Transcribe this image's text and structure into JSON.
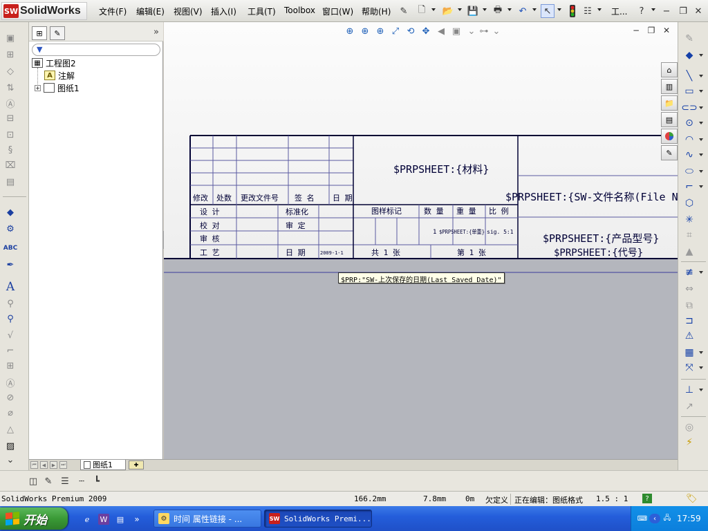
{
  "app": {
    "logo_text": "SolidWorks"
  },
  "menubar": {
    "items": [
      {
        "label": "文件(F)"
      },
      {
        "label": "编辑(E)"
      },
      {
        "label": "视图(V)"
      },
      {
        "label": "插入(I)"
      },
      {
        "label": "工具(T)"
      },
      {
        "label": "Toolbox"
      },
      {
        "label": "窗口(W)"
      },
      {
        "label": "帮助(H)"
      }
    ],
    "overflow_label": "工..."
  },
  "feature_tree": {
    "root": "工程图2",
    "children": [
      {
        "label": "注解",
        "icon": "annotation-icon",
        "icon_glyph": "A"
      },
      {
        "label": "图纸1",
        "icon": "sheet-icon",
        "expandable": true,
        "expander": "+"
      }
    ],
    "expand_glyph": "»"
  },
  "title_block": {
    "material": "$PRPSHEET:{材料}",
    "file_name": "$PRPSHEET:{SW-文件名称(File Name)}",
    "product_model": "$PRPSHEET:{产品型号}",
    "code": "$PRPSHEET:{代号}",
    "rev_headers": [
      "修改",
      "处数",
      "更改文件号",
      "签 名",
      "日 期"
    ],
    "row_labels": [
      "设 计",
      "校 对",
      "审 核",
      "工 艺"
    ],
    "standardization": "标准化",
    "approval": "审 定",
    "date_label": "日 期",
    "date_value": "2009-1-1",
    "drawing_mark": "图样标记",
    "quantity": "数 量",
    "weight": "重 量",
    "scale": "比 例",
    "quantity_value": "1",
    "weight_value": "$PRPSHEET:{单重}",
    "scale_value": "sig. 5:1",
    "total_sheets": "共 1 张",
    "sheet_number": "第 1 张"
  },
  "tooltip": "$PRP:\"SW-上次保存的日期(Last Saved Date)\"",
  "sheet_tabs": {
    "active": "图纸1"
  },
  "status_bar": {
    "product": "SolidWorks Premium 2009",
    "x": "166.2mm",
    "y": "7.8mm",
    "z": "0m",
    "state": "欠定义",
    "editing": "正在编辑：图纸格式",
    "scale": "1.5 : 1"
  },
  "taskbar": {
    "start_label": "开始",
    "tasks": [
      {
        "label": "时间 属性链接 - ..."
      },
      {
        "label": "SolidWorks Premi..."
      }
    ],
    "clock": "17:59"
  },
  "colors": {
    "border": "#000033",
    "grid": "#5a5aa0",
    "accent": "#1540a8",
    "taskbar": "#245edb",
    "start": "#3a9a36"
  }
}
